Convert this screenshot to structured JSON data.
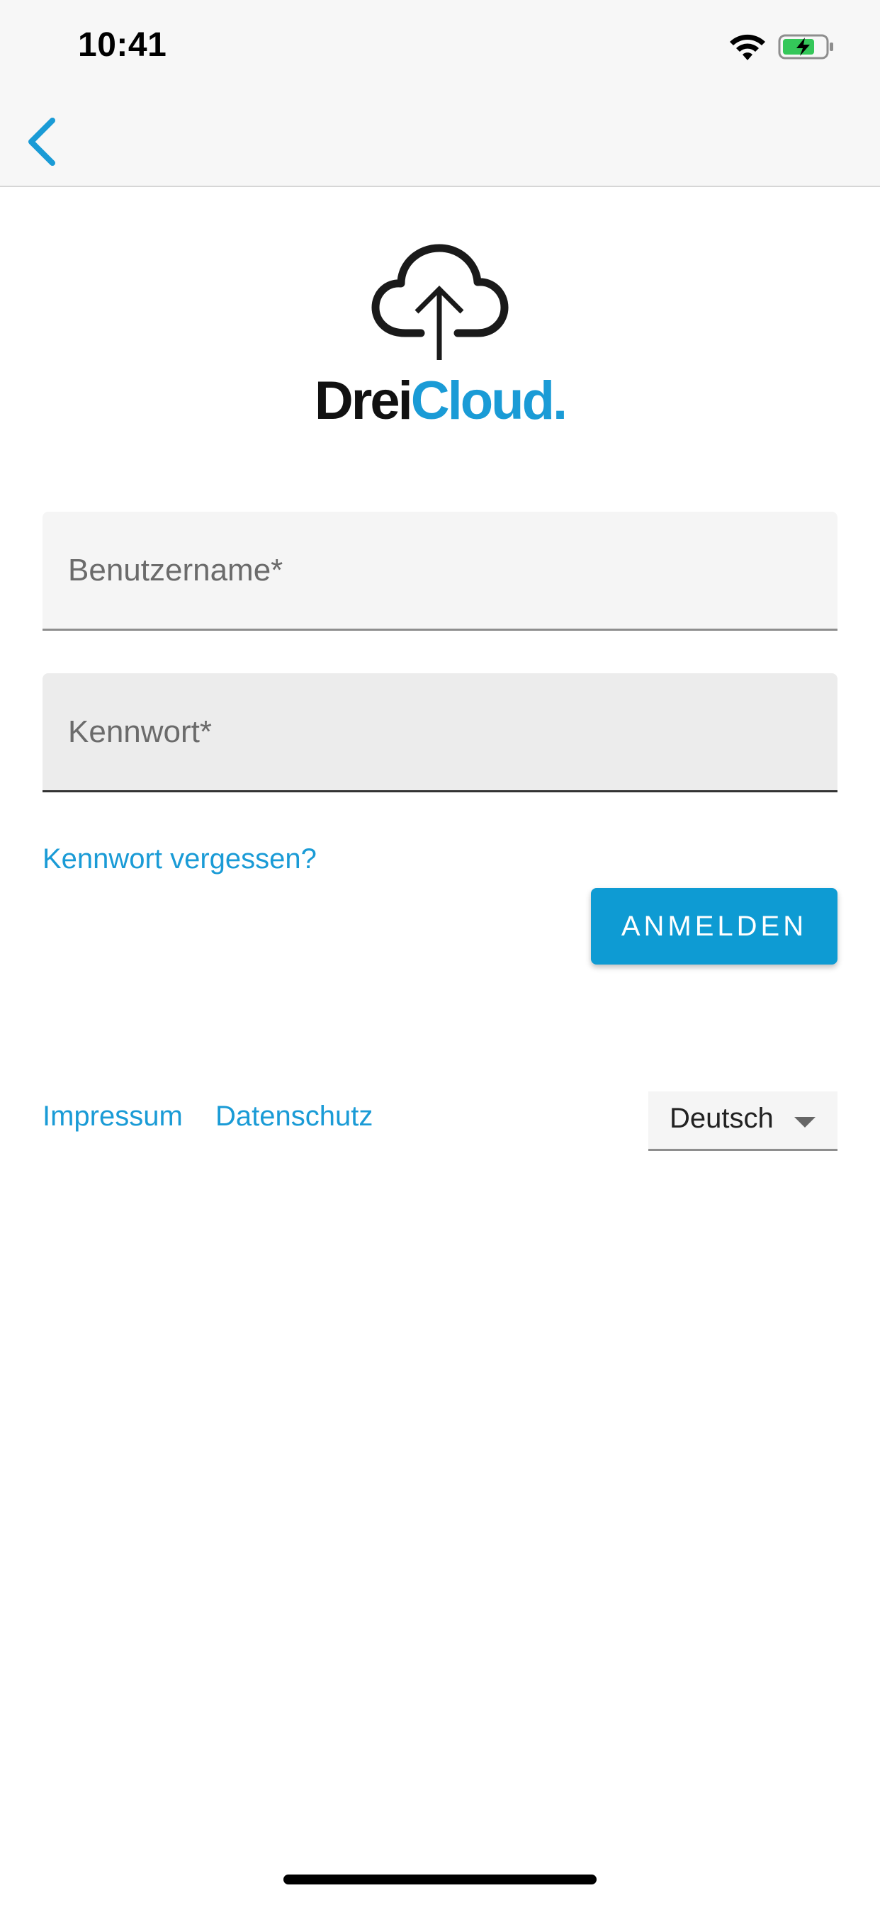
{
  "status_bar": {
    "time": "10:41",
    "icons": [
      "wifi-icon",
      "battery-charging-icon"
    ],
    "battery_color": "#34c759"
  },
  "nav": {
    "back_icon": "chevron-left-icon",
    "accent": "#1a9bd6"
  },
  "logo": {
    "icon": "cloud-upload-icon",
    "text_part1": "Drei",
    "text_part2": "Cloud."
  },
  "form": {
    "username_placeholder": "Benutzername*",
    "password_placeholder": "Kennwort*",
    "forgot_label": "Kennwort vergessen?",
    "login_label": "ANMELDEN"
  },
  "footer": {
    "impressum_label": "Impressum",
    "datenschutz_label": "Datenschutz",
    "language_selected": "Deutsch"
  },
  "colors": {
    "accent": "#1a9bd6",
    "button": "#0e9bd3"
  }
}
